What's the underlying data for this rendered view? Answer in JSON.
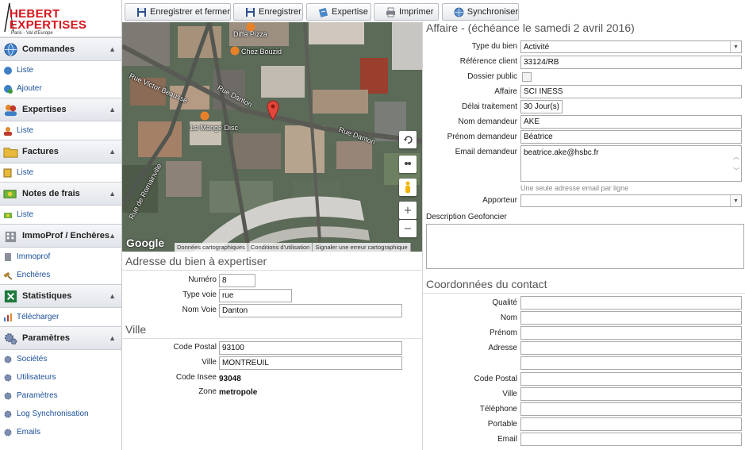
{
  "logo": {
    "line1": "HEBERT",
    "line2": "EXPERTISES",
    "line3": "Paris - Val d'Europe"
  },
  "sidebar": {
    "sections": [
      {
        "title": "Commandes",
        "icon": "globe-icon",
        "items": [
          "Liste",
          "Ajouter"
        ]
      },
      {
        "title": "Expertises",
        "icon": "people-icon",
        "items": [
          "Liste"
        ]
      },
      {
        "title": "Factures",
        "icon": "folder-icon",
        "items": [
          "Liste"
        ]
      },
      {
        "title": "Notes de frais",
        "icon": "money-icon",
        "items": [
          "Liste"
        ]
      },
      {
        "title": "ImmoProf / Enchères",
        "icon": "building-icon",
        "items": [
          "Immoprof",
          "Enchères"
        ]
      },
      {
        "title": "Statistiques",
        "icon": "excel-icon",
        "items": [
          "Télécharger"
        ]
      },
      {
        "title": "Paramètres",
        "icon": "gears-icon",
        "items": [
          "Sociétés",
          "Utilisateurs",
          "Paramètres",
          "Log Synchronisation",
          "Emails"
        ]
      }
    ]
  },
  "toolbar": {
    "save_close": "Enregistrer et fermer",
    "save": "Enregistrer",
    "expertise": "Expertise",
    "print": "Imprimer",
    "sync": "Synchroniser"
  },
  "map": {
    "labels": {
      "diffa": "Diffa Pizza",
      "bouzid": "Chez Bouzid",
      "beausse": "Rue Victor Beausse",
      "danton1": "Rue Danton",
      "danton2": "Rue Danton",
      "mange": "Le Mange Disc",
      "romainville": "Rue de Romainville"
    },
    "google": "Google",
    "footer": [
      "Données cartographiques",
      "Conditions d'utilisation",
      "Signaler une erreur cartographique"
    ],
    "controls": {
      "zoom_in": "+",
      "zoom_out": "−"
    }
  },
  "address": {
    "title": "Adresse du bien à expertiser",
    "numero_label": "Numéro",
    "numero": "8",
    "type_voie_label": "Type voie",
    "type_voie": "rue",
    "nom_voie_label": "Nom Voie",
    "nom_voie": "Danton",
    "ville_title": "Ville",
    "cp_label": "Code Postal",
    "cp": "93100",
    "ville_label": "Ville",
    "ville": "MONTREUIL",
    "insee_label": "Code Insee",
    "insee": "93048",
    "zone_label": "Zone",
    "zone": "metropole"
  },
  "affaire": {
    "title": "Affaire - (échéance le samedi 2 avril 2016)",
    "type_bien_label": "Type du bien",
    "type_bien": "Activité",
    "ref_label": "Référence client",
    "ref": "33124/RB",
    "dossier_label": "Dossier public",
    "affaire_label": "Affaire",
    "affaire": "SCI INESS",
    "delai_label": "Délai traitement",
    "delai": "30 Jour(s)",
    "nom_dem_label": "Nom demandeur",
    "nom_dem": "AKE",
    "prenom_dem_label": "Prénom demandeur",
    "prenom_dem": "Béatrice",
    "email_dem_label": "Email demandeur",
    "email_dem": "beatrice.ake@hsbc.fr",
    "email_hint": "Une seule adresse email par ligne",
    "apporteur_label": "Apporteur",
    "apporteur": "",
    "geo_label": "Description Geofoncier"
  },
  "contact": {
    "title": "Coordonnées du contact",
    "qualite": "Qualité",
    "nom": "Nom",
    "prenom": "Prénom",
    "adresse": "Adresse",
    "cp": "Code Postal",
    "ville": "Ville",
    "tel": "Téléphone",
    "portable": "Portable",
    "email": "Email"
  }
}
